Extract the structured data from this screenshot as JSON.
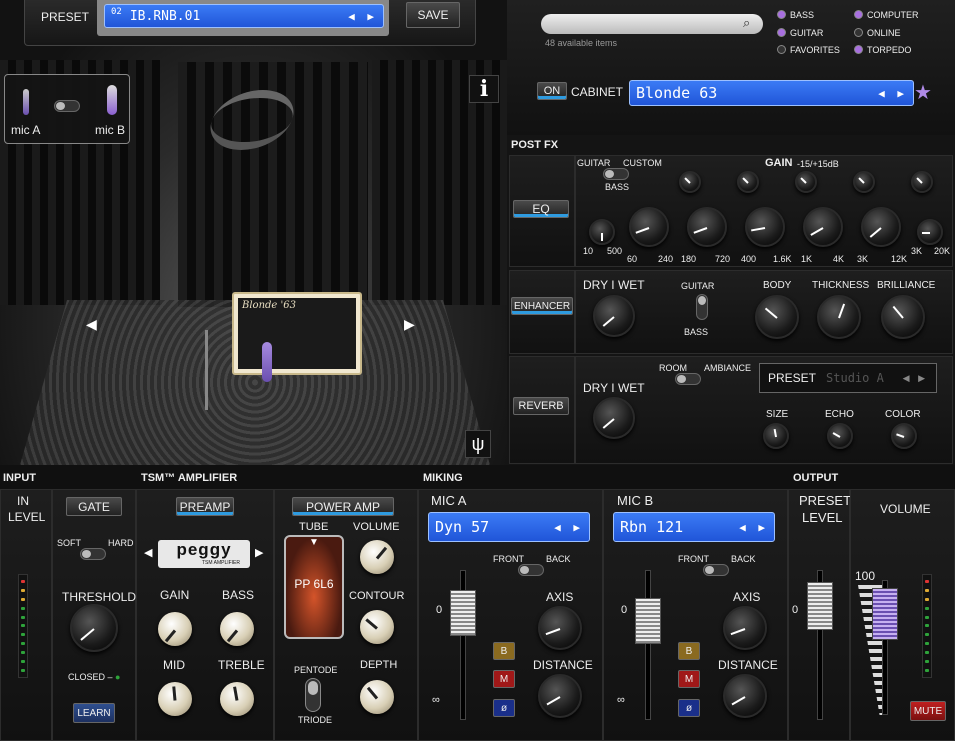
{
  "preset": {
    "label": "PRESET",
    "number": "02",
    "name": "IB.RNB.01",
    "save": "SAVE"
  },
  "stage": {
    "mic_a": "mic A",
    "mic_b": "mic B",
    "info": "i",
    "cab_label": "Blonde '63"
  },
  "browser": {
    "count": "48 available items",
    "filters": [
      "BASS",
      "GUITAR",
      "FAVORITES"
    ],
    "filters2": [
      "COMPUTER",
      "ONLINE",
      "TORPEDO"
    ],
    "on": "ON",
    "cabinet": "CABINET",
    "cabinet_name": "Blonde 63"
  },
  "postfx": {
    "title": "POST FX",
    "eq": "EQ",
    "guitar": "GUITAR",
    "custom": "CUSTOM",
    "bass": "BASS",
    "gain": "GAIN",
    "gain_range": "-15/+15dB",
    "freqs": [
      "10",
      "500",
      "60",
      "240",
      "180",
      "720",
      "400",
      "1.6K",
      "1K",
      "4K",
      "3K",
      "12K",
      "3K",
      "20K"
    ],
    "enhancer": "ENHANCER",
    "dry": "DRY",
    "sep": "I",
    "wet": "WET",
    "eguitar": "GUITAR",
    "ebass": "BASS",
    "body": "BODY",
    "thickness": "THICKNESS",
    "brilliance": "BRILLIANCE",
    "reverb": "REVERB",
    "room": "ROOM",
    "ambiance": "AMBIANCE",
    "rpreset": "PRESET",
    "rpreset_name": "Studio A",
    "size": "SIZE",
    "echo": "ECHO",
    "color": "COLOR"
  },
  "input": {
    "title": "INPUT",
    "in": "IN",
    "level": "LEVEL",
    "gate": "GATE",
    "soft": "SOFT",
    "hard": "HARD",
    "threshold": "THRESHOLD",
    "closed": "CLOSED",
    "learn": "LEARN"
  },
  "amp": {
    "title": "TSM™ AMPLIFIER",
    "preamp": "PREAMP",
    "power": "POWER AMP",
    "brand": "peggy",
    "brand_sub": "TSM AMPLIFIER",
    "tube": "TUBE",
    "tube_name": "PP 6L6",
    "volume": "VOLUME",
    "contour": "CONTOUR",
    "depth": "DEPTH",
    "gain": "GAIN",
    "bass": "BASS",
    "mid": "MID",
    "treble": "TREBLE",
    "pentode": "PENTODE",
    "triode": "TRIODE"
  },
  "miking": {
    "title": "MIKING",
    "a": {
      "label": "MIC A",
      "name": "Dyn 57"
    },
    "b": {
      "label": "MIC B",
      "name": "Rbn 121"
    },
    "front": "FRONT",
    "back": "BACK",
    "axis": "AXIS",
    "distance": "DISTANCE",
    "zero": "0",
    "inf": "∞",
    "bb": "B",
    "bm": "M",
    "bp": "ø"
  },
  "output": {
    "title": "OUTPUT",
    "preset": "PRESET",
    "level": "LEVEL",
    "volume": "VOLUME",
    "v100": "100",
    "zero": "0",
    "mute": "MUTE"
  }
}
